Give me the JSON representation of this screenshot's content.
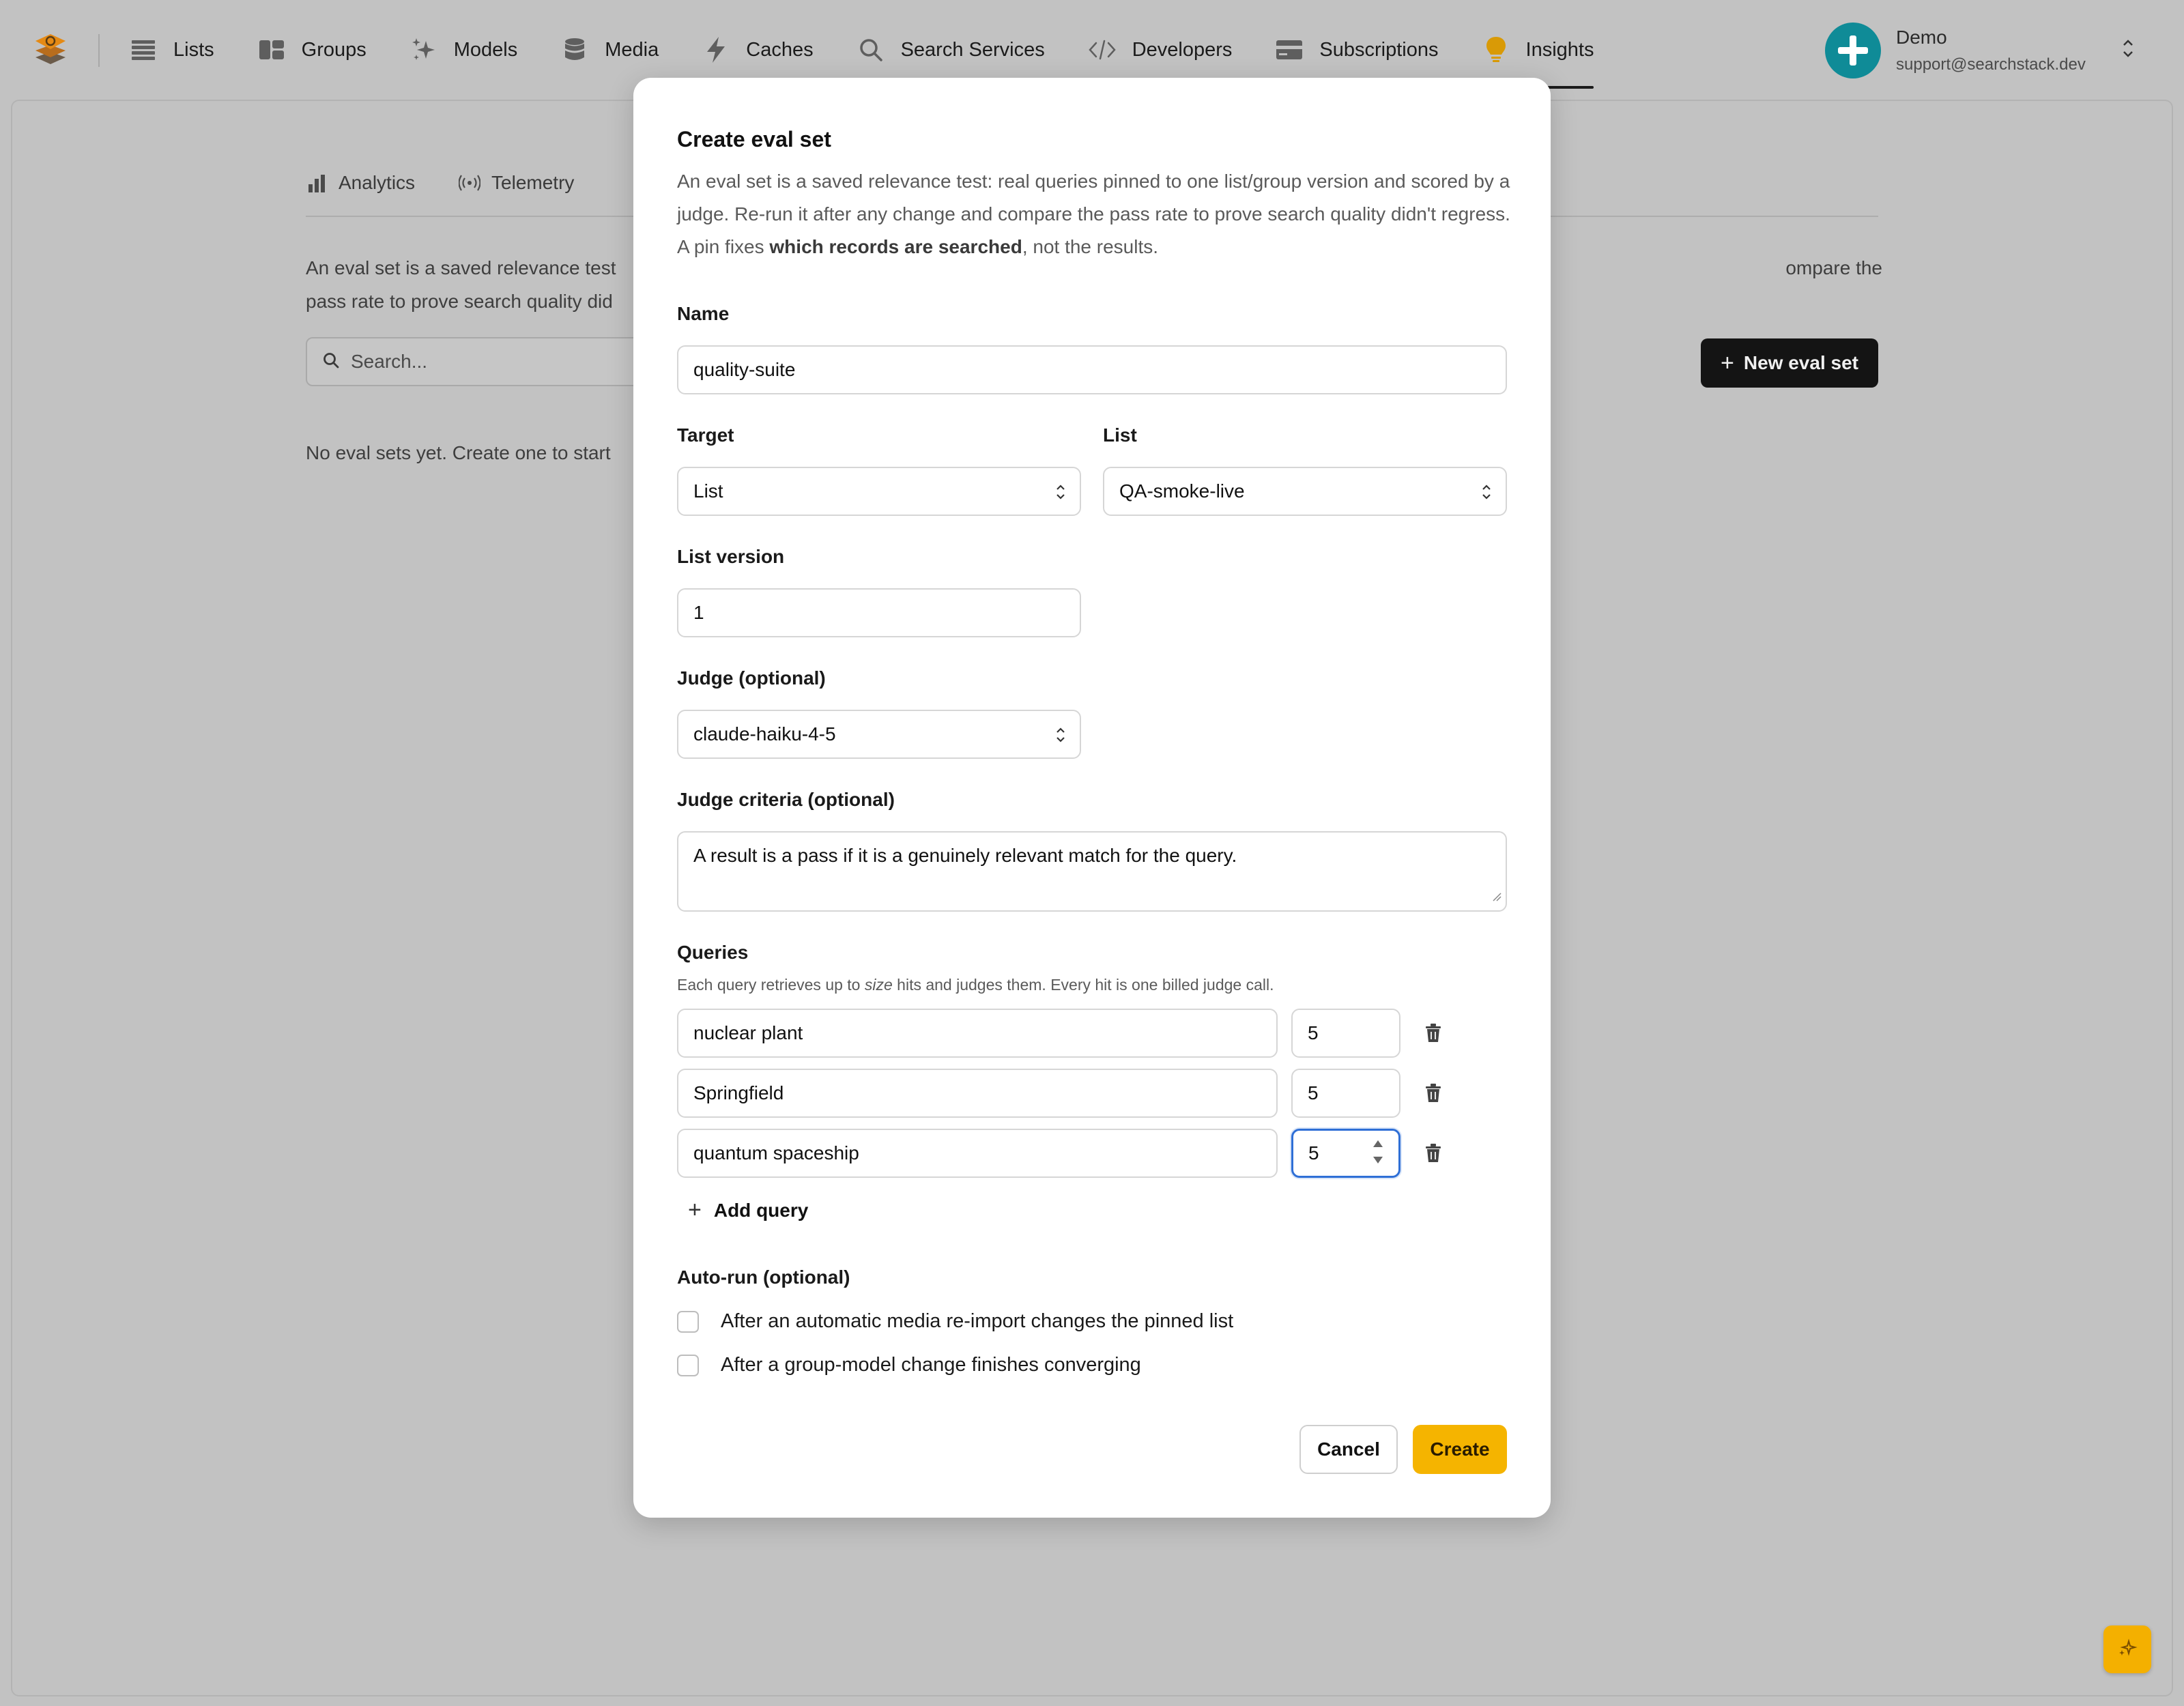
{
  "nav": {
    "items": [
      {
        "label": "Lists",
        "icon": "list-icon"
      },
      {
        "label": "Groups",
        "icon": "groups-icon"
      },
      {
        "label": "Models",
        "icon": "sparkle-icon"
      },
      {
        "label": "Media",
        "icon": "database-icon"
      },
      {
        "label": "Caches",
        "icon": "bolt-icon"
      },
      {
        "label": "Search Services",
        "icon": "search-icon"
      },
      {
        "label": "Developers",
        "icon": "code-icon"
      },
      {
        "label": "Subscriptions",
        "icon": "card-icon"
      },
      {
        "label": "Insights",
        "icon": "lightbulb-icon",
        "active": true
      }
    ],
    "account": {
      "name": "Demo",
      "email": "support@searchstack.dev"
    }
  },
  "background": {
    "tabs": [
      {
        "label": "Analytics",
        "icon": "bar-chart-icon"
      },
      {
        "label": "Telemetry",
        "icon": "broadcast-icon"
      }
    ],
    "description_left_1": "An eval set is a saved relevance test",
    "description_right_1": "ompare the",
    "description_left_2": "pass rate to prove search quality did",
    "search_placeholder": "Search...",
    "new_button": "New eval set",
    "empty_text": "No eval sets yet. Create one to start"
  },
  "modal": {
    "title": "Create eval set",
    "desc_part1": "An eval set is a saved relevance test: real queries pinned to one list/group version and scored by a judge. Re-run it after any change and compare the pass rate to prove search quality didn't regress. A pin fixes ",
    "desc_bold": "which records are searched",
    "desc_part2": ", not the results.",
    "name_label": "Name",
    "name_value": "quality-suite",
    "target_label": "Target",
    "target_value": "List",
    "list_label": "List",
    "list_value": "QA-smoke-live",
    "version_label": "List version",
    "version_value": "1",
    "judge_label": "Judge (optional)",
    "judge_value": "claude-haiku-4-5",
    "criteria_label": "Judge criteria (optional)",
    "criteria_value": "A result is a pass if it is a genuinely relevant match for the query.",
    "queries_label": "Queries",
    "queries_hint_1": "Each query retrieves up to ",
    "queries_hint_em": "size",
    "queries_hint_2": " hits and judges them. Every hit is one billed judge call.",
    "queries": [
      {
        "text": "nuclear plant",
        "size": "5"
      },
      {
        "text": "Springfield",
        "size": "5"
      },
      {
        "text": "quantum spaceship",
        "size": "5"
      }
    ],
    "add_query": "Add query",
    "autorun_label": "Auto-run (optional)",
    "autorun_options": [
      "After an automatic media re-import changes the pinned list",
      "After a group-model change finishes converging"
    ],
    "cancel": "Cancel",
    "create": "Create"
  },
  "colors": {
    "accent": "#f5b400",
    "avatar": "#0f8b97",
    "focus": "#2f6fd6",
    "overlay": "#c2c2c2"
  }
}
